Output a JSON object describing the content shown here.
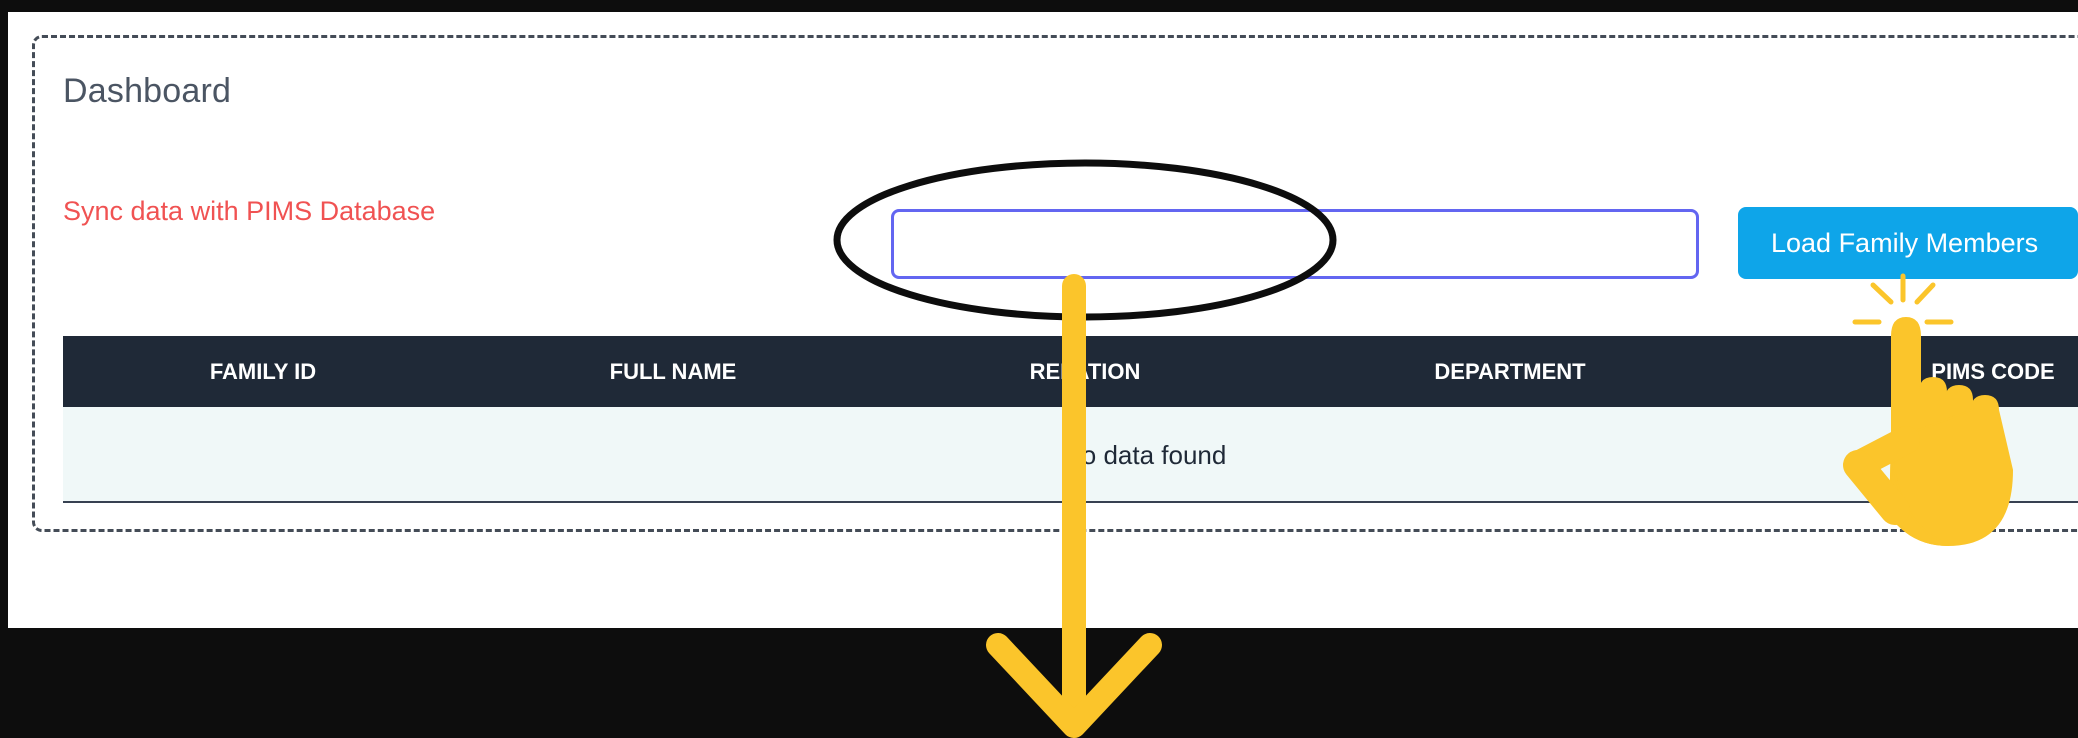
{
  "page_title": "Dashboard",
  "sync_link": "Sync data with PIMS Database",
  "search": {
    "value": "",
    "placeholder": ""
  },
  "load_button_label": "Load Family Members",
  "table": {
    "columns": [
      "FAMILY ID",
      "FULL NAME",
      "RELATION",
      "DEPARTMENT",
      "PIMS CODE"
    ],
    "empty_message": "No data found"
  },
  "colors": {
    "accent_button": "#0ea5e9",
    "input_focus_border": "#6366f1",
    "sync_link": "#f05252",
    "table_header_bg": "#1f2937",
    "annotation": "#fbc52b"
  },
  "annotations": {
    "highlight": "ellipse",
    "pointer": "hand-pointer-icon",
    "arrow": "arrow-down-icon"
  }
}
